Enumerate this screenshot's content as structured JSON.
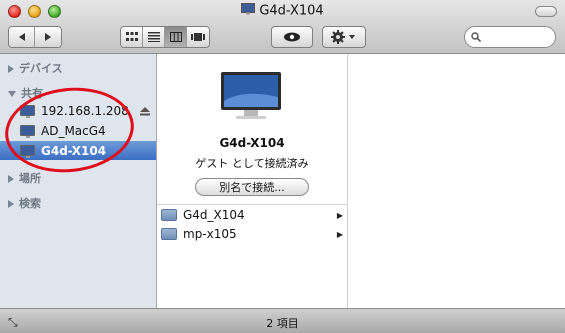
{
  "window": {
    "title": "G4d-X104"
  },
  "toolbar": {
    "back_icon": "back-icon",
    "forward_icon": "forward-icon",
    "view_modes": [
      "icon-view",
      "list-view",
      "column-view",
      "coverflow-view"
    ],
    "search_placeholder": ""
  },
  "sidebar": {
    "sections": {
      "devices": "デバイス",
      "shared": "共有",
      "places": "場所",
      "search": "検索"
    },
    "shared_items": [
      {
        "label": "192.168.1.208"
      },
      {
        "label": "AD_MacG4"
      },
      {
        "label": "G4d-X104"
      }
    ]
  },
  "preview": {
    "name": "G4d-X104",
    "status": "ゲスト として接続済み",
    "connect_as_label": "別名で接続...",
    "shares": [
      {
        "label": "G4d_X104"
      },
      {
        "label": "mp-x105"
      }
    ]
  },
  "statusbar": {
    "text": "2 項目"
  },
  "colors": {
    "selection": "#3b6fc3",
    "annotation": "#e00d1c",
    "sidebar_bg": "#dfe5ec"
  }
}
